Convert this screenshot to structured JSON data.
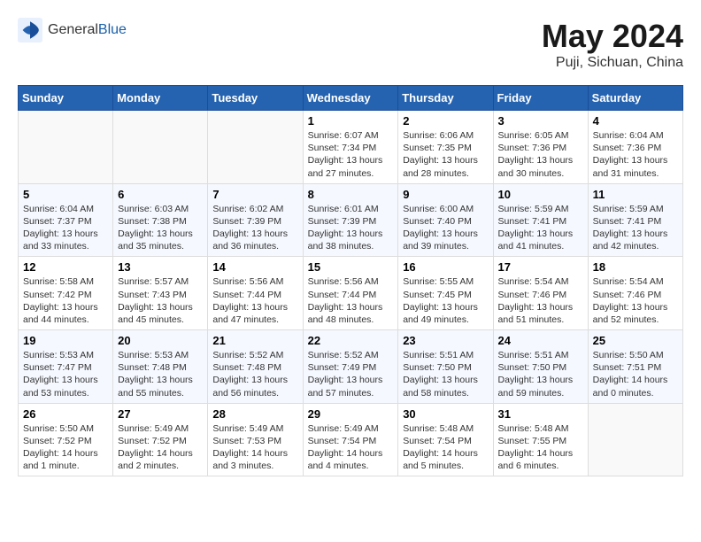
{
  "header": {
    "logo_general": "General",
    "logo_blue": "Blue",
    "title": "May 2024",
    "subtitle": "Puji, Sichuan, China"
  },
  "columns": [
    "Sunday",
    "Monday",
    "Tuesday",
    "Wednesday",
    "Thursday",
    "Friday",
    "Saturday"
  ],
  "weeks": [
    [
      {
        "day": "",
        "info": ""
      },
      {
        "day": "",
        "info": ""
      },
      {
        "day": "",
        "info": ""
      },
      {
        "day": "1",
        "info": "Sunrise: 6:07 AM\nSunset: 7:34 PM\nDaylight: 13 hours and 27 minutes."
      },
      {
        "day": "2",
        "info": "Sunrise: 6:06 AM\nSunset: 7:35 PM\nDaylight: 13 hours and 28 minutes."
      },
      {
        "day": "3",
        "info": "Sunrise: 6:05 AM\nSunset: 7:36 PM\nDaylight: 13 hours and 30 minutes."
      },
      {
        "day": "4",
        "info": "Sunrise: 6:04 AM\nSunset: 7:36 PM\nDaylight: 13 hours and 31 minutes."
      }
    ],
    [
      {
        "day": "5",
        "info": "Sunrise: 6:04 AM\nSunset: 7:37 PM\nDaylight: 13 hours and 33 minutes."
      },
      {
        "day": "6",
        "info": "Sunrise: 6:03 AM\nSunset: 7:38 PM\nDaylight: 13 hours and 35 minutes."
      },
      {
        "day": "7",
        "info": "Sunrise: 6:02 AM\nSunset: 7:39 PM\nDaylight: 13 hours and 36 minutes."
      },
      {
        "day": "8",
        "info": "Sunrise: 6:01 AM\nSunset: 7:39 PM\nDaylight: 13 hours and 38 minutes."
      },
      {
        "day": "9",
        "info": "Sunrise: 6:00 AM\nSunset: 7:40 PM\nDaylight: 13 hours and 39 minutes."
      },
      {
        "day": "10",
        "info": "Sunrise: 5:59 AM\nSunset: 7:41 PM\nDaylight: 13 hours and 41 minutes."
      },
      {
        "day": "11",
        "info": "Sunrise: 5:59 AM\nSunset: 7:41 PM\nDaylight: 13 hours and 42 minutes."
      }
    ],
    [
      {
        "day": "12",
        "info": "Sunrise: 5:58 AM\nSunset: 7:42 PM\nDaylight: 13 hours and 44 minutes."
      },
      {
        "day": "13",
        "info": "Sunrise: 5:57 AM\nSunset: 7:43 PM\nDaylight: 13 hours and 45 minutes."
      },
      {
        "day": "14",
        "info": "Sunrise: 5:56 AM\nSunset: 7:44 PM\nDaylight: 13 hours and 47 minutes."
      },
      {
        "day": "15",
        "info": "Sunrise: 5:56 AM\nSunset: 7:44 PM\nDaylight: 13 hours and 48 minutes."
      },
      {
        "day": "16",
        "info": "Sunrise: 5:55 AM\nSunset: 7:45 PM\nDaylight: 13 hours and 49 minutes."
      },
      {
        "day": "17",
        "info": "Sunrise: 5:54 AM\nSunset: 7:46 PM\nDaylight: 13 hours and 51 minutes."
      },
      {
        "day": "18",
        "info": "Sunrise: 5:54 AM\nSunset: 7:46 PM\nDaylight: 13 hours and 52 minutes."
      }
    ],
    [
      {
        "day": "19",
        "info": "Sunrise: 5:53 AM\nSunset: 7:47 PM\nDaylight: 13 hours and 53 minutes."
      },
      {
        "day": "20",
        "info": "Sunrise: 5:53 AM\nSunset: 7:48 PM\nDaylight: 13 hours and 55 minutes."
      },
      {
        "day": "21",
        "info": "Sunrise: 5:52 AM\nSunset: 7:48 PM\nDaylight: 13 hours and 56 minutes."
      },
      {
        "day": "22",
        "info": "Sunrise: 5:52 AM\nSunset: 7:49 PM\nDaylight: 13 hours and 57 minutes."
      },
      {
        "day": "23",
        "info": "Sunrise: 5:51 AM\nSunset: 7:50 PM\nDaylight: 13 hours and 58 minutes."
      },
      {
        "day": "24",
        "info": "Sunrise: 5:51 AM\nSunset: 7:50 PM\nDaylight: 13 hours and 59 minutes."
      },
      {
        "day": "25",
        "info": "Sunrise: 5:50 AM\nSunset: 7:51 PM\nDaylight: 14 hours and 0 minutes."
      }
    ],
    [
      {
        "day": "26",
        "info": "Sunrise: 5:50 AM\nSunset: 7:52 PM\nDaylight: 14 hours and 1 minute."
      },
      {
        "day": "27",
        "info": "Sunrise: 5:49 AM\nSunset: 7:52 PM\nDaylight: 14 hours and 2 minutes."
      },
      {
        "day": "28",
        "info": "Sunrise: 5:49 AM\nSunset: 7:53 PM\nDaylight: 14 hours and 3 minutes."
      },
      {
        "day": "29",
        "info": "Sunrise: 5:49 AM\nSunset: 7:54 PM\nDaylight: 14 hours and 4 minutes."
      },
      {
        "day": "30",
        "info": "Sunrise: 5:48 AM\nSunset: 7:54 PM\nDaylight: 14 hours and 5 minutes."
      },
      {
        "day": "31",
        "info": "Sunrise: 5:48 AM\nSunset: 7:55 PM\nDaylight: 14 hours and 6 minutes."
      },
      {
        "day": "",
        "info": ""
      }
    ]
  ]
}
